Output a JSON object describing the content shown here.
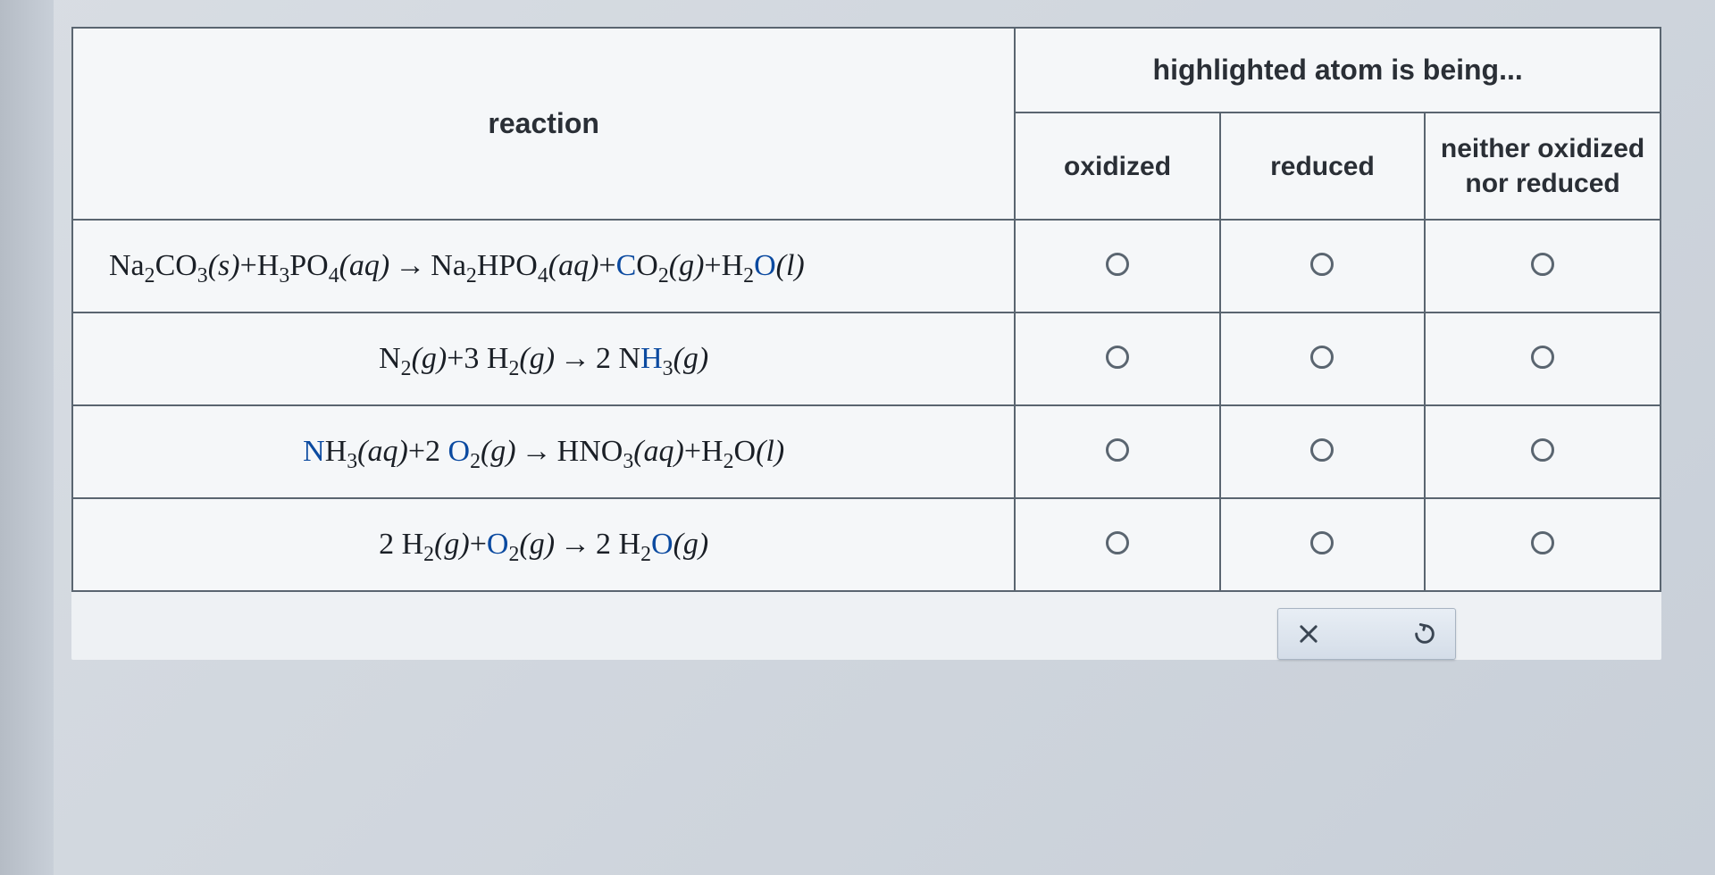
{
  "headers": {
    "reaction": "reaction",
    "super": "highlighted atom is being...",
    "oxidized": "oxidized",
    "reduced": "reduced",
    "neither": "neither oxidized nor reduced"
  },
  "reactions": [
    {
      "parts": {
        "p1": "Na",
        "s1": "2",
        "p2": "CO",
        "s2": "3",
        "st1": "(s)",
        "plus1": "+H",
        "s3": "3",
        "p3": "PO",
        "s4": "4",
        "st2": "(aq)",
        "arr": " → ",
        "p4": "Na",
        "s5": "2",
        "p5": "HPO",
        "s6": "4",
        "st3": "(aq)",
        "plus2": "+",
        "hl1": "C",
        "p6": "O",
        "s7": "2",
        "st4": "(g)",
        "plus3": "+H",
        "s8": "2",
        "hl2": "O",
        "st5": "(l)"
      }
    },
    {
      "parts": {
        "p1": "N",
        "s1": "2",
        "st1": "(g)",
        "plus1": "+3 H",
        "s2": "2",
        "st2": "(g)",
        "arr": " → ",
        "p2": "2 N",
        "hl1": "H",
        "s3": "3",
        "st3": "(g)"
      }
    },
    {
      "parts": {
        "hl1": "N",
        "p1": "H",
        "s1": "3",
        "st1": "(aq)",
        "plus1": "+2 ",
        "hl2": "O",
        "s2": "2",
        "st2": "(g)",
        "arr": " → ",
        "p2": "HNO",
        "s3": "3",
        "st3": "(aq)",
        "plus2": "+H",
        "s4": "2",
        "p3": "O",
        "st4": "(l)"
      }
    },
    {
      "parts": {
        "p1": "2 H",
        "s1": "2",
        "st1": "(g)",
        "plus1": "+",
        "hl1": "O",
        "s2": "2",
        "st2": "(g)",
        "arr": " → ",
        "p2": "2 H",
        "s3": "2",
        "hl2": "O",
        "st3": "(g)"
      }
    }
  ],
  "actions": {
    "clear": "×",
    "reset": "↺"
  }
}
